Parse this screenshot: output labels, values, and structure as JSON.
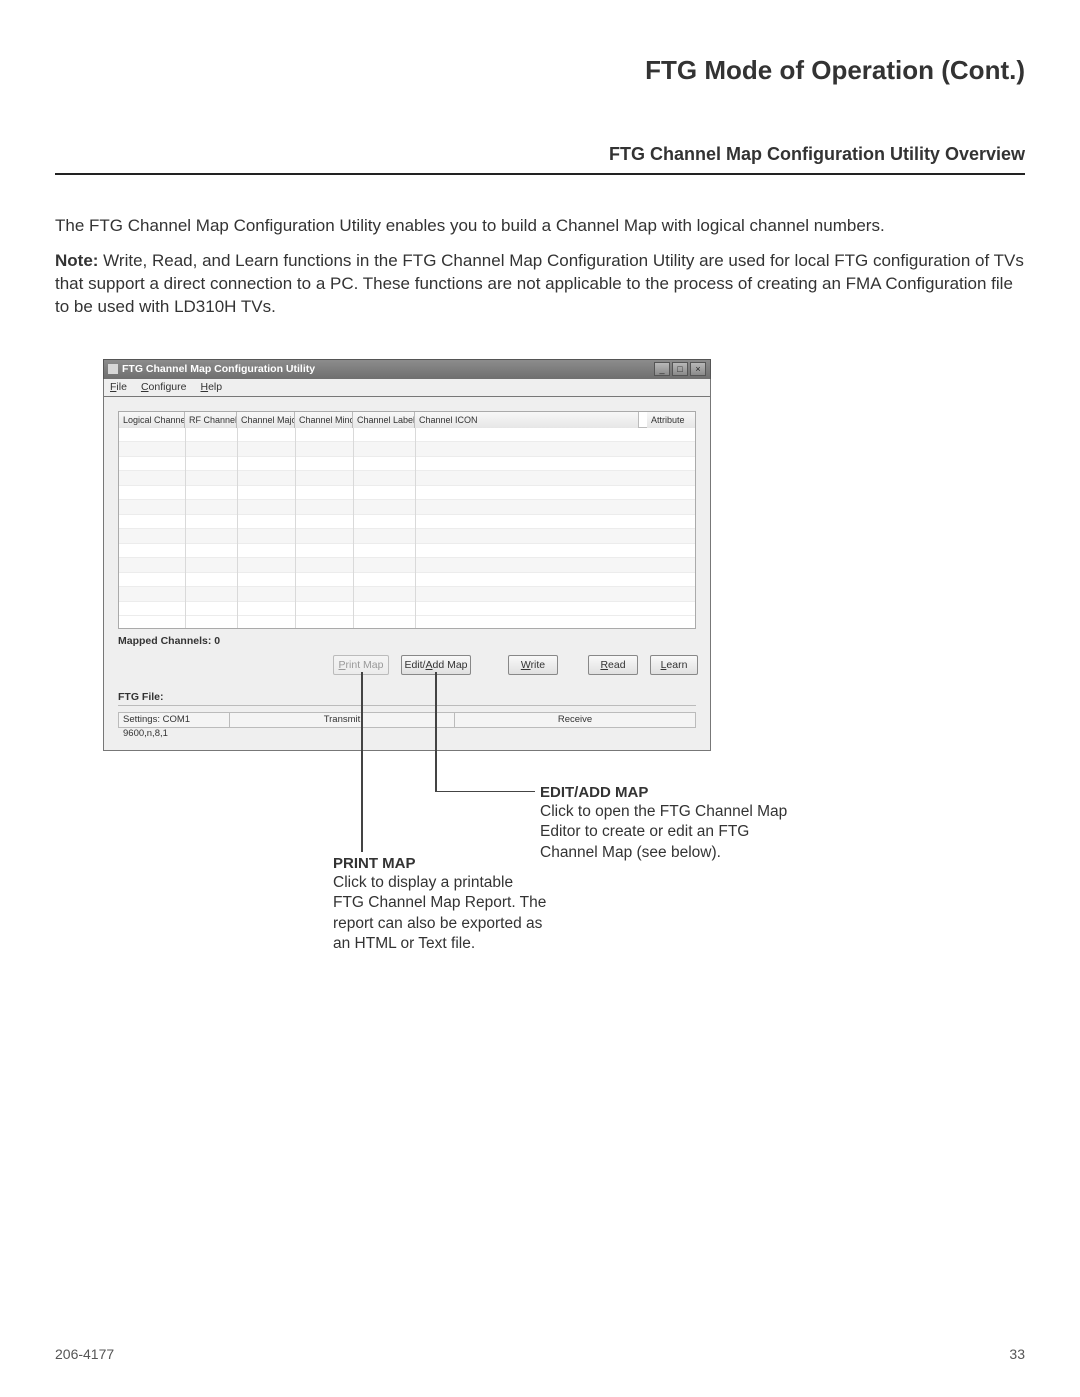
{
  "page": {
    "title": "FTG Mode of Operation (Cont.)",
    "section": "FTG Channel Map Configuration Utility Overview",
    "paragraph1": "The FTG Channel Map Configuration Utility enables you to build a Channel Map with logical channel numbers.",
    "note_label": "Note:",
    "note_text": " Write, Read, and Learn functions in the FTG Channel Map Configuration Utility are used for local FTG configuration of TVs that support a direct connection to a PC. These functions are not applicable to the process of creating an FMA Configuration file to be used with LD310H TVs."
  },
  "window": {
    "title": "FTG Channel Map Configuration Utility",
    "menus": {
      "file": "File",
      "configure": "Configure",
      "help": "Help"
    },
    "columns": [
      "Logical Channel",
      "RF Channel",
      "Channel Major",
      "Channel Minor",
      "Channel Label",
      "Channel ICON"
    ],
    "attribute_col": "Attribute",
    "mapped_label": "Mapped Channels: 0",
    "buttons": {
      "print": "Print Map",
      "edit": "Edit/Add Map",
      "write": "Write",
      "read": "Read",
      "learn": "Learn"
    },
    "ftg_file": "FTG File:",
    "settings": "Settings: COM1 9600,n,8,1",
    "transmit": "Transmit",
    "receive": "Receive",
    "winbtn": {
      "min": "_",
      "max": "□",
      "close": "×"
    }
  },
  "callouts": {
    "print": {
      "title": "PRINT MAP",
      "text": "Click to display a printable FTG Channel Map Report. The report can also be exported as an HTML or Text file."
    },
    "edit": {
      "title": "EDIT/ADD MAP",
      "text": "Click to open the FTG Channel Map Editor to create or edit an FTG Channel Map (see below)."
    }
  },
  "footer": {
    "doc": "206-4177",
    "page": "33"
  }
}
